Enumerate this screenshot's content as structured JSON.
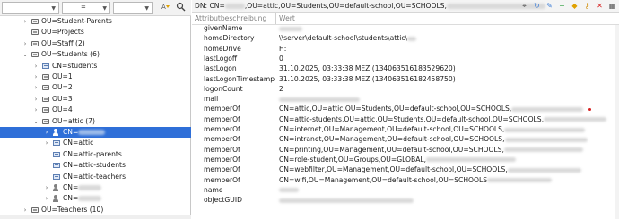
{
  "colors": {
    "selection": "#2f6fd8",
    "accent_icon": "#e0a100"
  },
  "left_toolbar": {
    "combo1_value": "",
    "combo2_value": "=",
    "combo3_value": "",
    "btn1_icon": "font-filter-icon",
    "btn2_icon": "search-icon"
  },
  "tree": [
    {
      "toggle": "collapsed",
      "icon": "ou",
      "label": "OU=Student-Parents"
    },
    {
      "toggle": "none",
      "icon": "ou",
      "label": "OU=Projects"
    },
    {
      "toggle": "collapsed",
      "icon": "ou",
      "label": "OU=Staff (2)"
    },
    {
      "toggle": "expanded",
      "icon": "ou",
      "label": "OU=Students (6)"
    },
    {
      "toggle": "collapsed",
      "icon": "cn",
      "label": "CN=students"
    },
    {
      "toggle": "collapsed",
      "icon": "ou",
      "label": "OU=1"
    },
    {
      "toggle": "collapsed",
      "icon": "ou",
      "label": "OU=2"
    },
    {
      "toggle": "collapsed",
      "icon": "ou",
      "label": "OU=3"
    },
    {
      "toggle": "collapsed",
      "icon": "ou",
      "label": "OU=4"
    },
    {
      "toggle": "expanded",
      "icon": "ou",
      "label": "OU=attic (7)"
    },
    {
      "toggle": "collapsed",
      "icon": "user",
      "label": "CN=",
      "selected": true
    },
    {
      "toggle": "collapsed",
      "icon": "cn",
      "label": "CN=attic"
    },
    {
      "toggle": "none",
      "icon": "cn",
      "label": "CN=attic-parents"
    },
    {
      "toggle": "none",
      "icon": "cn",
      "label": "CN=attic-students"
    },
    {
      "toggle": "none",
      "icon": "cn",
      "label": "CN=attic-teachers"
    },
    {
      "toggle": "collapsed",
      "icon": "user",
      "label": "CN="
    },
    {
      "toggle": "collapsed",
      "icon": "user",
      "label": "CN="
    },
    {
      "toggle": "collapsed",
      "icon": "ou",
      "label": "OU=Teachers (10)"
    }
  ],
  "right_toolbar": {
    "dn_prefix": "DN: CN=",
    "dn_mid": ",OU=attic,OU=Students,OU=default-school,OU=SCHOOLS,",
    "icons": [
      "filter-icon",
      "refresh-icon",
      "edit-icon",
      "add-icon",
      "tag-icon",
      "key-icon",
      "delete-icon",
      "layout-icon"
    ]
  },
  "columns": {
    "attribute": "Attributbeschreibung",
    "value": "Wert"
  },
  "rows": [
    {
      "k": "givenName",
      "v": "",
      "blur_v": true
    },
    {
      "k": "homeDirectory",
      "v": "\\\\server\\default-school\\students\\attic\\",
      "blur_tail": true
    },
    {
      "k": "homeDrive",
      "v": "H:"
    },
    {
      "k": "lastLogoff",
      "v": "0"
    },
    {
      "k": "lastLogon",
      "v": "31.10.2025, 03:33:38 MEZ (134063516183529620)"
    },
    {
      "k": "lastLogonTimestamp",
      "v": "31.10.2025, 03:33:38 MEZ (134063516182458750)"
    },
    {
      "k": "logonCount",
      "v": "2"
    },
    {
      "k": "mail",
      "v": "",
      "blur_v": true
    },
    {
      "k": "memberOf",
      "v": "CN=attic,OU=attic,OU=Students,OU=default-school,OU=SCHOOLS,",
      "blur_tail": true,
      "dot": true
    },
    {
      "k": "memberOf",
      "v": "CN=attic-students,OU=attic,OU=Students,OU=default-school,OU=SCHOOLS,",
      "blur_tail": true
    },
    {
      "k": "memberOf",
      "v": "CN=internet,OU=Management,OU=default-school,OU=SCHOOLS,",
      "blur_tail": true
    },
    {
      "k": "memberOf",
      "v": "CN=intranet,OU=Management,OU=default-school,OU=SCHOOLS,",
      "blur_tail": true
    },
    {
      "k": "memberOf",
      "v": "CN=printing,OU=Management,OU=default-school,OU=SCHOOLS,",
      "blur_tail": true
    },
    {
      "k": "memberOf",
      "v": "CN=role-student,OU=Groups,OU=GLOBAL,",
      "blur_tail": true
    },
    {
      "k": "memberOf",
      "v": "CN=webfilter,OU=Management,OU=default-school,OU=SCHOOLS,",
      "blur_tail": true
    },
    {
      "k": "memberOf",
      "v": "CN=wifi,OU=Management,OU=default-school,OU=SCHOOLS",
      "blur_tail": true
    },
    {
      "k": "name",
      "v": "",
      "blur_v": true
    },
    {
      "k": "objectGUID",
      "v": "",
      "blur_v": true
    }
  ]
}
